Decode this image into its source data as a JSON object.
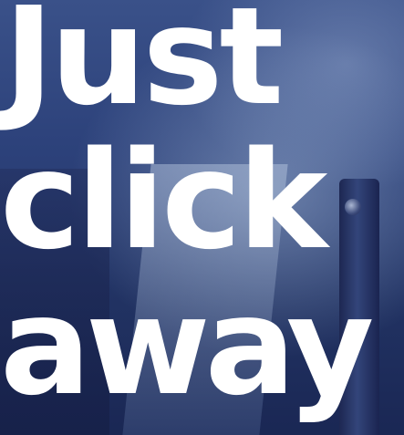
{
  "headline": {
    "lines": [
      "Just",
      "click",
      "away"
    ]
  },
  "colors": {
    "text": "#ffffff",
    "background_top": "#3a5189",
    "background_bottom": "#1a2754"
  }
}
